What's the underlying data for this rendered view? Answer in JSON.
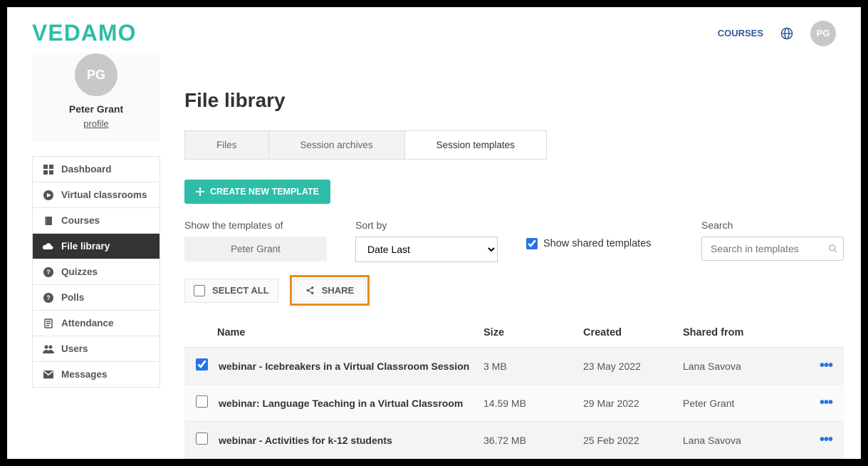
{
  "brand": "VEDAMO",
  "header": {
    "courses": "COURSES",
    "avatar_initials": "PG"
  },
  "user": {
    "initials": "PG",
    "name": "Peter Grant",
    "profile_link": "profile"
  },
  "sidebar": {
    "items": [
      {
        "label": "Dashboard",
        "icon": "dashboard"
      },
      {
        "label": "Virtual classrooms",
        "icon": "play"
      },
      {
        "label": "Courses",
        "icon": "book"
      },
      {
        "label": "File library",
        "icon": "cloud",
        "active": true
      },
      {
        "label": "Quizzes",
        "icon": "question"
      },
      {
        "label": "Polls",
        "icon": "question"
      },
      {
        "label": "Attendance",
        "icon": "file"
      },
      {
        "label": "Users",
        "icon": "users"
      },
      {
        "label": "Messages",
        "icon": "envelope"
      }
    ]
  },
  "page": {
    "title": "File library",
    "tabs": [
      {
        "label": "Files"
      },
      {
        "label": "Session archives"
      },
      {
        "label": "Session templates",
        "active": true
      }
    ],
    "create_button": "CREATE NEW TEMPLATE",
    "filters": {
      "owner_label": "Show the templates of",
      "owner_value": "Peter Grant",
      "sort_label": "Sort by",
      "sort_value": "Date Last",
      "show_shared_label": "Show shared templates",
      "show_shared_checked": true,
      "search_label": "Search",
      "search_placeholder": "Search in templates"
    },
    "actions": {
      "select_all": "SELECT ALL",
      "share": "SHARE"
    },
    "columns": {
      "name": "Name",
      "size": "Size",
      "created": "Created",
      "shared_from": "Shared from"
    },
    "rows": [
      {
        "checked": true,
        "name": "webinar - Icebreakers in a Virtual Classroom Session",
        "size": "3 MB",
        "created": "23 May 2022",
        "shared_from": "Lana Savova"
      },
      {
        "checked": false,
        "name": "webinar: Language Teaching in a Virtual Classroom",
        "size": "14.59 MB",
        "created": "29 Mar 2022",
        "shared_from": "Peter Grant"
      },
      {
        "checked": false,
        "name": "webinar - Activities for k-12 students",
        "size": "36.72 MB",
        "created": "25 Feb 2022",
        "shared_from": "Lana Savova"
      }
    ]
  }
}
